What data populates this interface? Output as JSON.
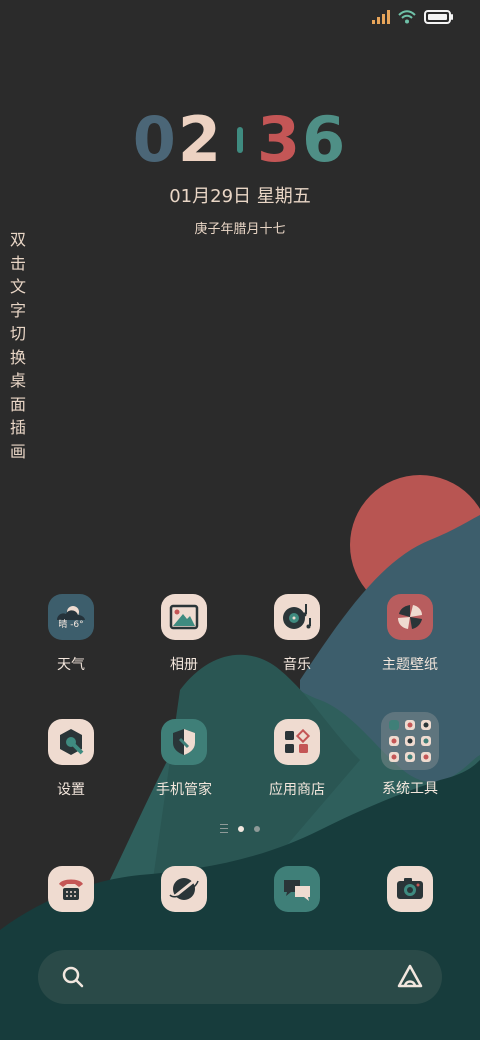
{
  "status_bar": {
    "signal_icon": "signal-bars-icon",
    "wifi_icon": "wifi-icon",
    "battery_icon": "battery-icon"
  },
  "clock": {
    "h1": "0",
    "h2": "2",
    "m1": "3",
    "m2": "6",
    "date": "01月29日  星期五",
    "lunar": "庚子年腊月十七"
  },
  "side_hint": "双击文字切换桌面插画",
  "apps_row1": [
    {
      "label": "天气",
      "icon": "weather-icon",
      "weather_text": "晴 -6°"
    },
    {
      "label": "相册",
      "icon": "gallery-icon"
    },
    {
      "label": "音乐",
      "icon": "music-icon"
    },
    {
      "label": "主题壁纸",
      "icon": "themes-icon"
    }
  ],
  "apps_row2": [
    {
      "label": "设置",
      "icon": "settings-icon"
    },
    {
      "label": "手机管家",
      "icon": "security-shield-icon"
    },
    {
      "label": "应用商店",
      "icon": "app-store-icon"
    },
    {
      "label": "系统工具",
      "icon": "folder-icon"
    }
  ],
  "dock": [
    {
      "icon": "phone-icon"
    },
    {
      "icon": "browser-icon"
    },
    {
      "icon": "messages-icon"
    },
    {
      "icon": "camera-icon"
    }
  ],
  "search": {
    "icon": "search-icon",
    "brand_icon": "assistant-icon"
  },
  "colors": {
    "background": "#2b2b2b",
    "sun": "#b85552",
    "mountain_far": "#3d5e6c",
    "mountain_mid": "#2f5f5c",
    "mountain_front": "#173c3c",
    "clock_teal": "#3f8b80",
    "clock_red": "#c45656"
  }
}
